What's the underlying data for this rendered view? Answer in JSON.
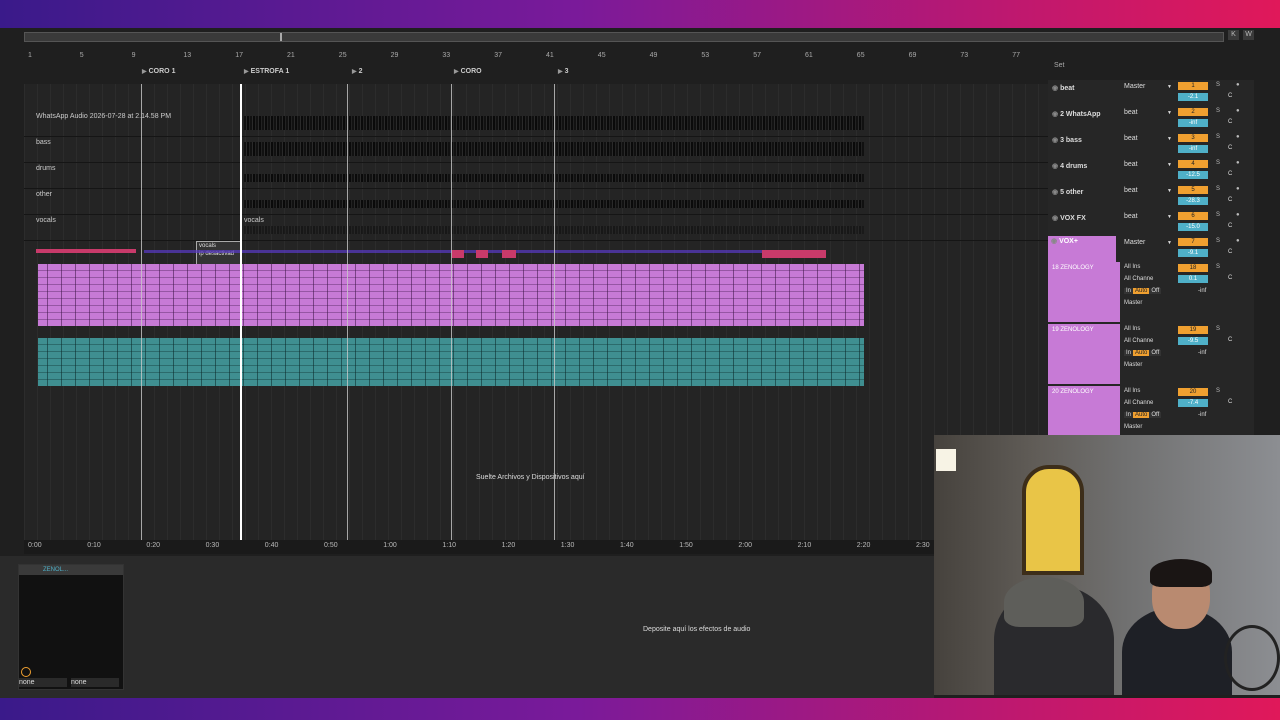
{
  "overview": {
    "buttons": [
      "K",
      "W"
    ]
  },
  "set_label": "Set",
  "ruler": [
    "1",
    "5",
    "9",
    "13",
    "17",
    "21",
    "25",
    "29",
    "33",
    "37",
    "41",
    "45",
    "49",
    "53",
    "57",
    "61",
    "65",
    "69",
    "73",
    "77"
  ],
  "locators": [
    "CORO 1",
    "ESTROFA 1",
    "2",
    "CORO",
    "3"
  ],
  "lanes": [
    {
      "name": "WhatsApp Audio 2026-07-28 at 2.14.58 PM"
    },
    {
      "name": "bass"
    },
    {
      "name": "drums"
    },
    {
      "name": "other"
    },
    {
      "name": "vocals"
    }
  ],
  "vocals_clip": {
    "label": "vocals",
    "sub": "ip desactivad"
  },
  "vocals_label2": "vocals",
  "arrangement_drop": "Suelte Archivos y Dispositivos aquí",
  "timeline": [
    "0:00",
    "0:10",
    "0:20",
    "0:30",
    "0:40",
    "0:50",
    "1:00",
    "1:10",
    "1:20",
    "1:30",
    "1:40",
    "1:50",
    "2:00",
    "2:10",
    "2:20",
    "2:30"
  ],
  "mixer": {
    "tracks": [
      {
        "name": "beat",
        "route": "Master",
        "num": "1",
        "vol": "-2.1"
      },
      {
        "name": "2 WhatsApp",
        "route": "beat",
        "num": "2",
        "vol": "-inf"
      },
      {
        "name": "3 bass",
        "route": "beat",
        "num": "3",
        "vol": "-inf"
      },
      {
        "name": "4 drums",
        "route": "beat",
        "num": "4",
        "vol": "-12.5"
      },
      {
        "name": "5 other",
        "route": "beat",
        "num": "5",
        "vol": "-28.3"
      },
      {
        "name": "VOX FX",
        "route": "beat",
        "num": "6",
        "vol": "-15.0"
      },
      {
        "name": "VOX+",
        "route": "Master",
        "num": "7",
        "vol": "-9.1"
      }
    ],
    "zen": [
      {
        "name": "18 ZENOLOGY",
        "num": "18",
        "vol": "0.1",
        "inlabel": "All Ins",
        "chan": "All Channe",
        "out": "Master"
      },
      {
        "name": "19 ZENOLOGY",
        "num": "19",
        "vol": "-9.5",
        "inlabel": "All Ins",
        "chan": "All Channe",
        "out": "Master"
      },
      {
        "name": "20 ZENOLOGY",
        "num": "20",
        "vol": "-7.4",
        "inlabel": "All Ins",
        "chan": "All Channe",
        "out": "Master"
      }
    ],
    "io": {
      "in": "In",
      "auto": "Auto",
      "off": "Off"
    },
    "s_label": "S",
    "c_label": "C",
    "inf": "-inf"
  },
  "device": {
    "title": "ZENOL...",
    "sel1": "none",
    "sel2": "none"
  },
  "device_drop": "Deposite aquí los efectos de audio"
}
